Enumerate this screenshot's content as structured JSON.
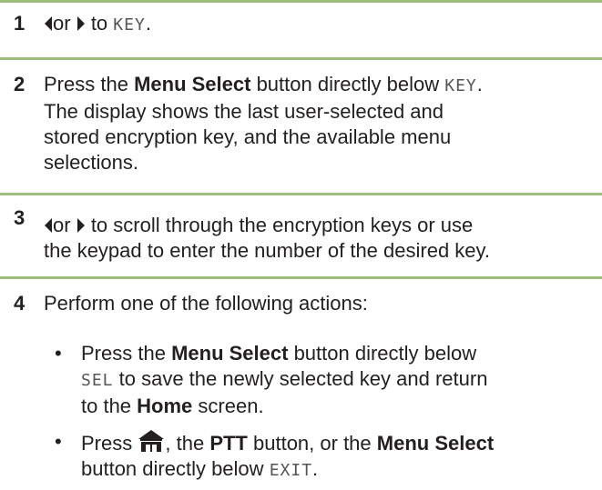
{
  "colors": {
    "rule": "#9dbd7a",
    "text": "#231f20"
  },
  "steps": [
    {
      "number": "1",
      "or": "or",
      "to": "to",
      "key": "KEY",
      "end": ".",
      "icons": [
        "left-arrow-icon",
        "right-arrow-icon"
      ]
    },
    {
      "number": "2",
      "press": "Press the",
      "menu_select": "Menu Select",
      "directly_below": "button directly below",
      "key": "KEY",
      "end": ".",
      "line2": "The display shows the last user-selected and",
      "line3": "stored encryption key, and the available menu",
      "line4": "selections."
    },
    {
      "number": "3",
      "or": "or",
      "line1_rest": "to scroll through the encryption keys or use",
      "line2": "the keypad to enter the number of the desired key."
    },
    {
      "number": "4",
      "text": "Perform one of the following actions:",
      "bullets": [
        {
          "symbol": "•",
          "press": "Press the",
          "menu_select": "Menu Select",
          "directly_below": "button directly below",
          "sel": "SEL",
          "rest": "to save the newly selected key and return",
          "to_the": "to the",
          "home": "Home",
          "screen": "screen."
        },
        {
          "symbol": "•",
          "press": "Press",
          "after_icon": ", the",
          "ptt": "PTT",
          "button_or": "button, or the",
          "menu_select": "Menu Select",
          "line2": "button directly below",
          "exit": "EXIT",
          "end": "."
        }
      ]
    }
  ]
}
